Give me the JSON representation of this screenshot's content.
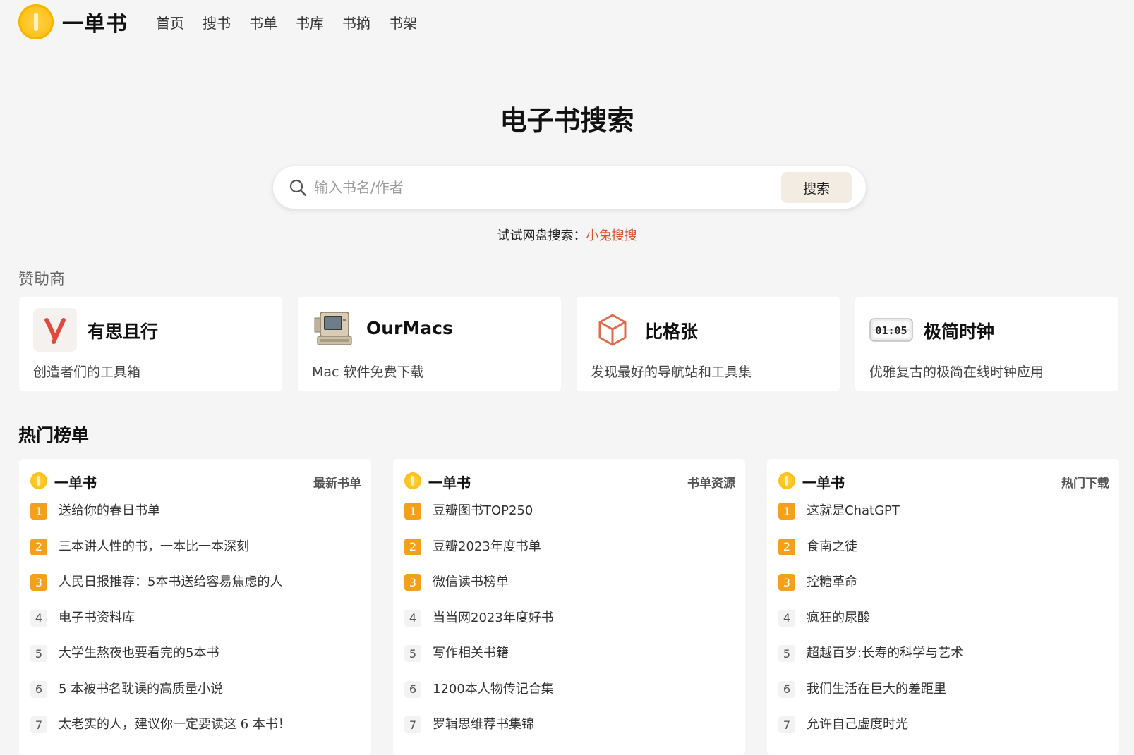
{
  "header": {
    "brand": "一单书",
    "nav": [
      "首页",
      "搜书",
      "书单",
      "书库",
      "书摘",
      "书架"
    ]
  },
  "hero": {
    "title": "电子书搜索",
    "search_placeholder": "输入书名/作者",
    "search_button": "搜索",
    "tip_prefix": "试试网盘搜索：",
    "tip_link": "小兔搜搜"
  },
  "sponsors": {
    "label": "赞助商",
    "items": [
      {
        "name": "有思且行",
        "desc": "创造者们的工具箱",
        "icon": "y-letter-logo"
      },
      {
        "name": "OurMacs",
        "desc": "Mac 软件免费下载",
        "icon": "retro-mac-logo"
      },
      {
        "name": "比格张",
        "desc": "发现最好的导航站和工具集",
        "icon": "cube-logo"
      },
      {
        "name": "极简时钟",
        "desc": "优雅复古的极简在线时钟应用",
        "icon": "flip-clock-logo",
        "clock_text": "01:05"
      }
    ]
  },
  "hot": {
    "title": "热门榜单",
    "lists": [
      {
        "brand": "一单书",
        "tag": "最新书单",
        "items": [
          "送给你的春日书单",
          "三本讲人性的书，一本比一本深刻",
          "人民日报推荐：5本书送给容易焦虑的人",
          "电子书资料库",
          "大学生熬夜也要看完的5本书",
          "5 本被书名耽误的高质量小说",
          "太老实的人，建议你一定要读这 6 本书！"
        ]
      },
      {
        "brand": "一单书",
        "tag": "书单资源",
        "items": [
          "豆瓣图书TOP250",
          "豆瓣2023年度书单",
          "微信读书榜单",
          "当当网2023年度好书",
          "写作相关书籍",
          "1200本人物传记合集",
          "罗辑思维荐书集锦"
        ]
      },
      {
        "brand": "一单书",
        "tag": "热门下载",
        "items": [
          "这就是ChatGPT",
          "食南之徒",
          "控糖革命",
          "疯狂的尿酸",
          "超越百岁:长寿的科学与艺术",
          "我们生活在巨大的差距里",
          "允许自己虚度时光"
        ]
      }
    ],
    "ranks": [
      "1",
      "2",
      "3",
      "4",
      "5",
      "6",
      "7"
    ]
  },
  "colors": {
    "accent": "#f5a01a",
    "link": "#d9532c",
    "brand_coin": "#ffc21a"
  }
}
